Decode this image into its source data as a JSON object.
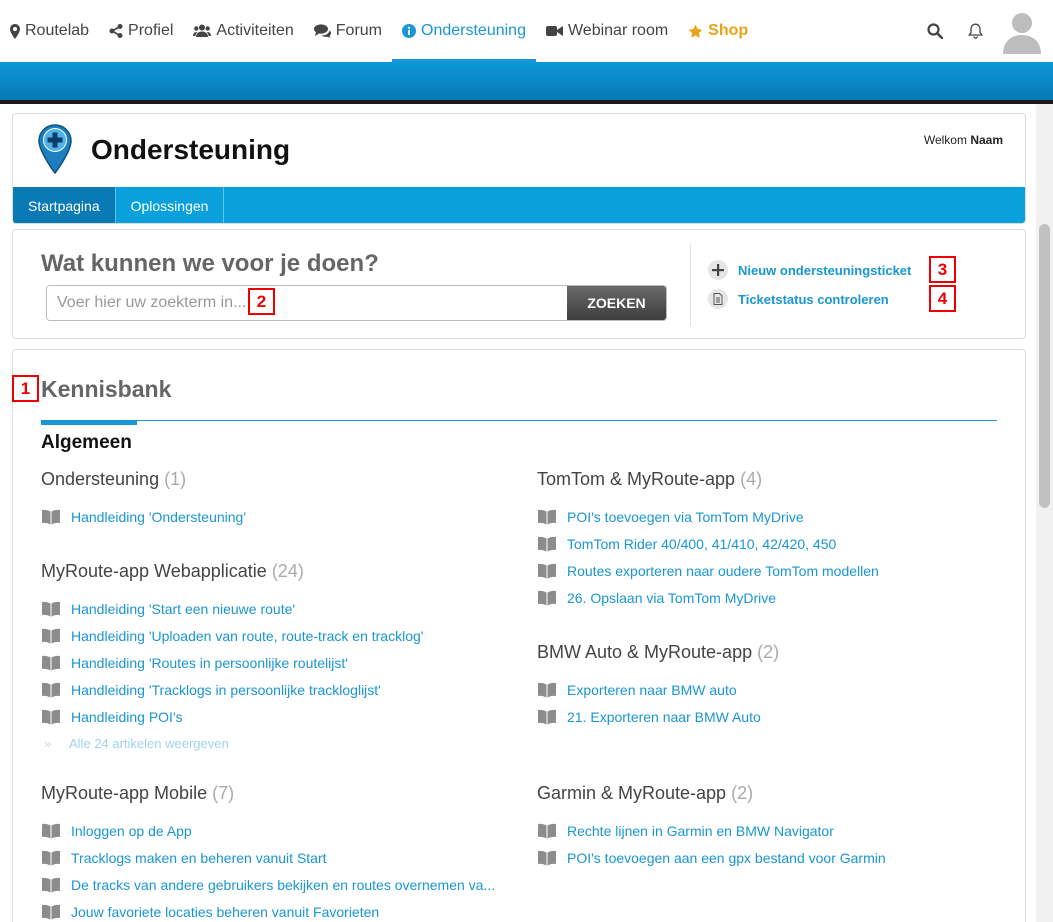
{
  "topnav": {
    "items": [
      {
        "label": "Routelab",
        "icon": "map-marker-icon"
      },
      {
        "label": "Profiel",
        "icon": "share-icon"
      },
      {
        "label": "Activiteiten",
        "icon": "users-icon"
      },
      {
        "label": "Forum",
        "icon": "comments-icon"
      },
      {
        "label": "Ondersteuning",
        "icon": "info-circle-icon"
      },
      {
        "label": "Webinar room",
        "icon": "video-camera-icon"
      },
      {
        "label": "Shop",
        "icon": "star-icon"
      }
    ],
    "active_index": 4
  },
  "header": {
    "title": "Ondersteuning",
    "welcome_prefix": "Welkom",
    "welcome_name": "Naam",
    "tabs": [
      {
        "label": "Startpagina"
      },
      {
        "label": "Oplossingen"
      }
    ]
  },
  "search": {
    "title": "Wat kunnen we voor je doen?",
    "placeholder": "Voer hier uw zoekterm in...",
    "button_label": "ZOEKEN"
  },
  "actions": {
    "new_ticket": "Nieuw ondersteuningsticket",
    "ticket_status": "Ticketstatus controleren"
  },
  "knowledge_base": {
    "title": "Kennisbank",
    "category": "Algemeen",
    "left": [
      {
        "title": "Ondersteuning",
        "count": "(1)",
        "articles": [
          "Handleiding 'Ondersteuning'"
        ]
      },
      {
        "title": "MyRoute-app Webapplicatie",
        "count": "(24)",
        "articles": [
          "Handleiding 'Start een nieuwe route'",
          "Handleiding 'Uploaden van route, route-track en tracklog'",
          "Handleiding 'Routes in persoonlijke routelijst'",
          "Handleiding 'Tracklogs in persoonlijke trackloglijst'",
          "Handleiding POI's"
        ],
        "more": "Alle 24 artikelen weergeven"
      },
      {
        "title": "MyRoute-app Mobile",
        "count": "(7)",
        "articles": [
          "Inloggen op de App",
          "Tracklogs maken en beheren vanuit Start",
          "De tracks van andere gebruikers bekijken en routes overnemen va...",
          "Jouw favoriete locaties beheren vanuit Favorieten"
        ]
      }
    ],
    "right": [
      {
        "title": "TomTom & MyRoute-app",
        "count": "(4)",
        "articles": [
          "POI's toevoegen via TomTom MyDrive",
          "TomTom Rider 40/400, 41/410, 42/420, 450",
          "Routes exporteren naar oudere TomTom modellen",
          "26. Opslaan via TomTom MyDrive"
        ]
      },
      {
        "title": "BMW Auto & MyRoute-app",
        "count": "(2)",
        "articles": [
          "Exporteren naar BMW auto",
          "21. Exporteren naar BMW Auto"
        ]
      },
      {
        "title": "Garmin & MyRoute-app",
        "count": "(2)",
        "articles": [
          "Rechte lijnen in Garmin en BMW Navigator",
          "POI's toevoegen aan een gpx bestand voor Garmin"
        ]
      }
    ]
  },
  "markers": [
    "1",
    "2",
    "3",
    "4"
  ],
  "colors": {
    "accent": "#1996d3",
    "shop": "#e8a317",
    "marker": "#ee0000"
  }
}
